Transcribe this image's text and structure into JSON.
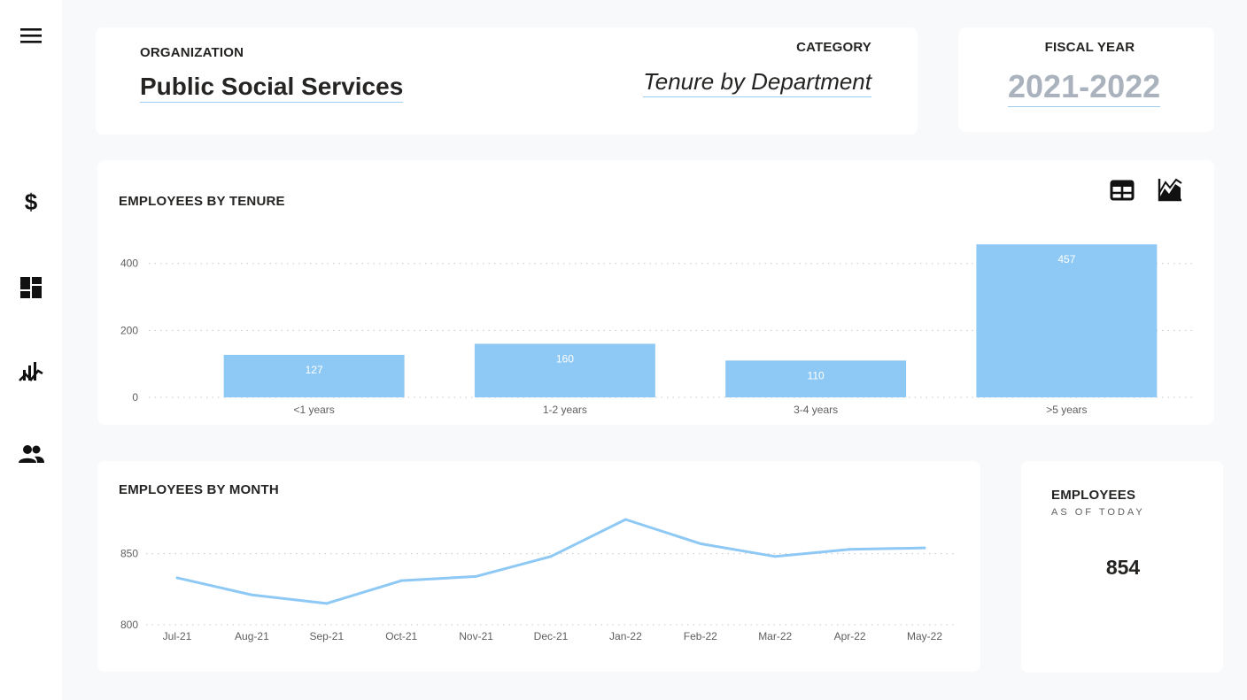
{
  "sidebar": {
    "items": [
      {
        "icon": "menu-icon"
      },
      {
        "icon": "dollar-icon"
      },
      {
        "icon": "dashboard-icon"
      },
      {
        "icon": "trend-chart-icon"
      },
      {
        "icon": "people-icon"
      }
    ]
  },
  "header": {
    "organization_label": "ORGANIZATION",
    "organization_value": "Public Social Services",
    "category_label": "CATEGORY",
    "category_value": "Tenure by Department",
    "fiscal_year_label": "FISCAL YEAR",
    "fiscal_year_value": "2021-2022"
  },
  "tenure": {
    "title": "EMPLOYEES BY TENURE",
    "icons": [
      "table-icon",
      "area-chart-icon"
    ]
  },
  "month": {
    "title": "EMPLOYEES BY MONTH"
  },
  "employees_kpi": {
    "title": "EMPLOYEES",
    "subtitle": "AS OF TODAY",
    "value": "854"
  },
  "colors": {
    "accent": "#8ec9f5",
    "underline": "#9fcdf0",
    "muted_year": "#aab2bd",
    "background": "#f8f9fb"
  },
  "chart_data": [
    {
      "type": "bar",
      "title": "EMPLOYEES BY TENURE",
      "categories": [
        "<1 years",
        "1-2 years",
        "3-4 years",
        ">5 years"
      ],
      "values": [
        127,
        160,
        110,
        457
      ],
      "y_ticks": [
        0,
        200,
        400
      ],
      "ylim": [
        0,
        460
      ],
      "grid": true,
      "data_labels": true
    },
    {
      "type": "line",
      "title": "EMPLOYEES BY MONTH",
      "categories": [
        "Jul-21",
        "Aug-21",
        "Sep-21",
        "Oct-21",
        "Nov-21",
        "Dec-21",
        "Jan-22",
        "Feb-22",
        "Mar-22",
        "Apr-22",
        "May-22"
      ],
      "values": [
        833,
        821,
        815,
        831,
        834,
        848,
        874,
        857,
        848,
        853,
        854
      ],
      "y_ticks": [
        800,
        850
      ],
      "ylim": [
        800,
        874
      ],
      "grid": true
    }
  ]
}
